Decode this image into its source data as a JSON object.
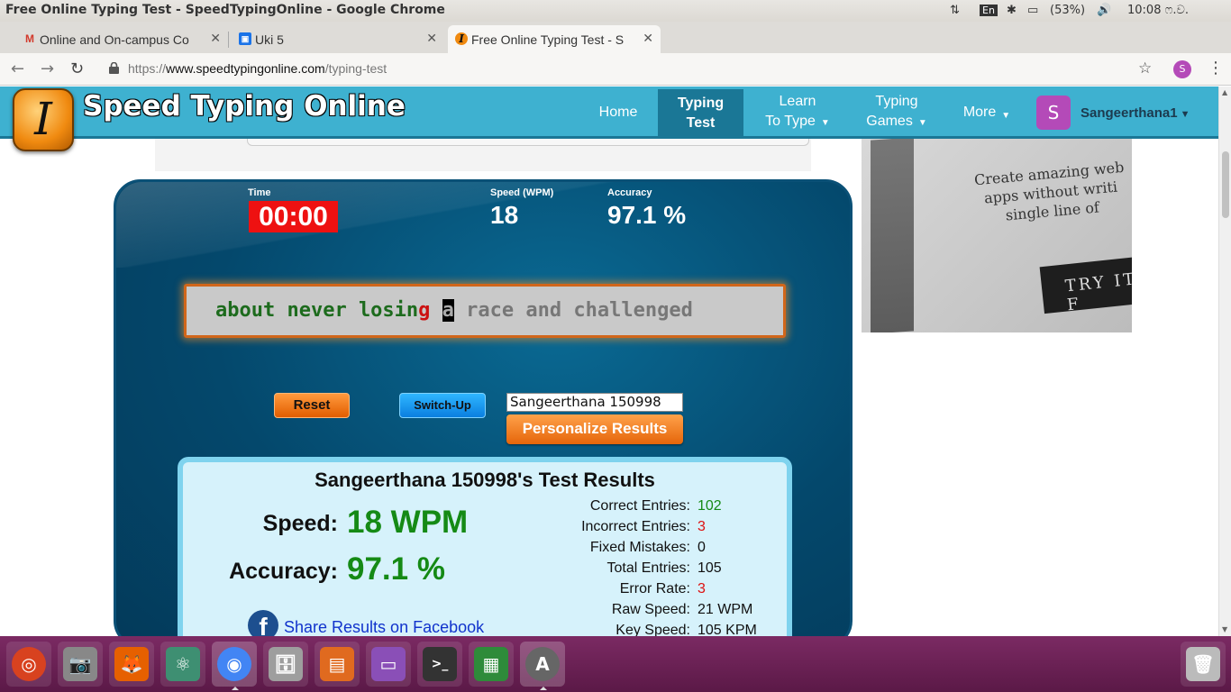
{
  "os": {
    "window_title": "Free Online Typing Test - SpeedTypingOnline - Google Chrome",
    "keyboard": "En",
    "battery": "(53%)",
    "clock": "10:08 ෆ.ව."
  },
  "tabs": [
    {
      "title": "Online and On-campus Co",
      "icon": "gmail-icon"
    },
    {
      "title": "Uki 5",
      "icon": "classroom-icon"
    },
    {
      "title": "Free Online Typing Test - S",
      "icon": "speedtyping-icon"
    }
  ],
  "toolbar": {
    "url_scheme": "https://",
    "url_host": "www.speedtypingonline.com",
    "url_path": "/typing-test",
    "profile_initial": "S"
  },
  "site": {
    "logo_letter": "I",
    "name": "Speed Typing Online",
    "nav": [
      {
        "label": "Home"
      },
      {
        "label_line1": "Typing",
        "label_line2": "Test"
      },
      {
        "label_line1": "Learn",
        "label_line2": "To Type"
      },
      {
        "label_line1": "Typing",
        "label_line2": "Games"
      },
      {
        "label": "More"
      }
    ],
    "user_initial": "S",
    "user_name": "Sangeerthana1"
  },
  "ad": {
    "text": "Create amazing web apps without writi single line of",
    "button": "TRY IT F"
  },
  "test": {
    "time_label": "Time",
    "time_value": "00:00",
    "speed_label": "Speed (WPM)",
    "speed_value": "18",
    "accuracy_label": "Accuracy",
    "accuracy_value": "97.1 %",
    "text_correct": "about never losin",
    "text_wrong": "g",
    "text_space": " ",
    "text_cursor": "a",
    "text_remaining": " race and challenged",
    "reset_label": "Reset",
    "switch_label": "Switch-Up",
    "name_value": "Sangeerthana 150998",
    "personalize_label": "Personalize Results"
  },
  "results": {
    "title": "Sangeerthana 150998's Test Results",
    "speed_label": "Speed:",
    "speed_value": "18 WPM",
    "accuracy_label": "Accuracy:",
    "accuracy_value": "97.1 %",
    "details": [
      {
        "label": "Correct Entries:",
        "value": "102",
        "color": "green"
      },
      {
        "label": "Incorrect Entries:",
        "value": "3",
        "color": "red"
      },
      {
        "label": "Fixed Mistakes:",
        "value": "0",
        "color": "black"
      },
      {
        "label": "Total Entries:",
        "value": "105",
        "color": "black"
      },
      {
        "label": "Error Rate:",
        "value": "3",
        "color": "red"
      },
      {
        "label": "Raw Speed:",
        "value": "21 WPM",
        "color": "black"
      },
      {
        "label": "Key Speed:",
        "value": "105 KPM",
        "color": "black"
      }
    ],
    "facebook_link": "Share Results on Facebook"
  },
  "launcher": [
    {
      "name": "ubuntu-dash-icon",
      "glyph": "◎"
    },
    {
      "name": "camera-app-icon",
      "glyph": "📷"
    },
    {
      "name": "firefox-icon",
      "glyph": "🦊"
    },
    {
      "name": "atom-icon",
      "glyph": "⚛"
    },
    {
      "name": "chrome-icon",
      "glyph": "◉"
    },
    {
      "name": "files-icon",
      "glyph": "🗄"
    },
    {
      "name": "impress-icon",
      "glyph": "▤"
    },
    {
      "name": "window-app-icon",
      "glyph": "▭"
    },
    {
      "name": "terminal-icon",
      "glyph": ">_"
    },
    {
      "name": "calc-icon",
      "glyph": "▦"
    },
    {
      "name": "software-updater-icon",
      "glyph": "A"
    },
    {
      "name": "trash-icon",
      "glyph": "🗑"
    }
  ],
  "colors": {
    "header": "#3eb1d0",
    "nav_active": "#1a7796",
    "panel": "#04486c",
    "timer": "#ee1111",
    "accent_orange": "#e5650a",
    "result_green": "#158a15",
    "result_red": "#dd1111"
  }
}
